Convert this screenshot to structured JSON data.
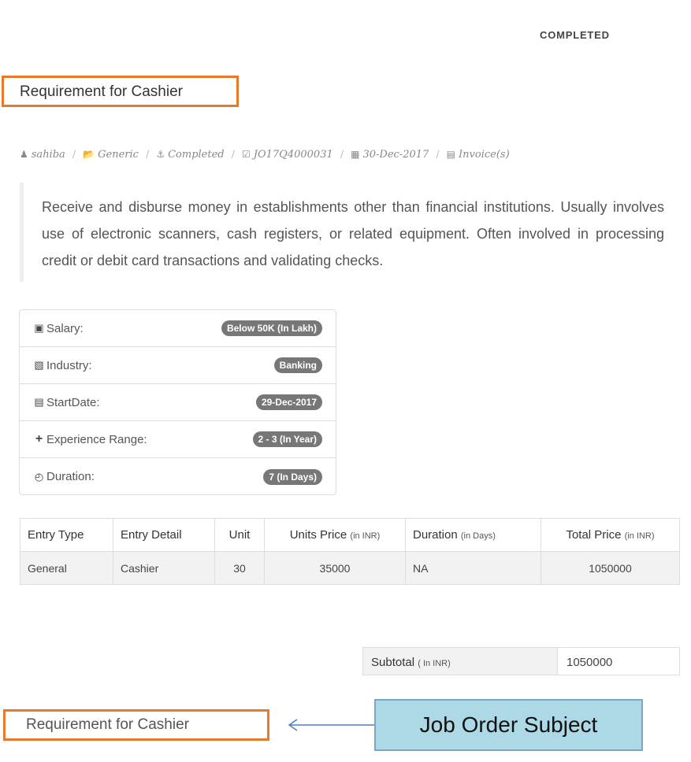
{
  "status": "COMPLETED",
  "title": "Requirement for Cashier",
  "meta": {
    "user": "sahiba",
    "category": "Generic",
    "state": "Completed",
    "job_id": "JO17Q4000031",
    "date": "30-Dec-2017",
    "invoice": "Invoice(s)",
    "separator": "/"
  },
  "description": "Receive and disburse money in establishments other than financial institutions. Usually involves use of electronic scanners, cash registers, or related equipment. Often involved in processing credit or debit card transactions and validating checks.",
  "details": [
    {
      "icon": "money-icon",
      "label": "Salary:",
      "value": "Below 50K  (In Lakh)"
    },
    {
      "icon": "building-icon",
      "label": "Industry:",
      "value": "Banking"
    },
    {
      "icon": "ticket-icon",
      "label": "StartDate:",
      "value": "29-Dec-2017"
    },
    {
      "icon": "plus-icon",
      "label": "Experience Range:",
      "value": "2 - 3   (In Year)"
    },
    {
      "icon": "clock-icon",
      "label": "Duration:",
      "value": "7  (In Days)"
    }
  ],
  "table": {
    "headers": [
      {
        "label": "Entry Type",
        "unit": ""
      },
      {
        "label": "Entry Detail",
        "unit": ""
      },
      {
        "label": "Unit",
        "unit": ""
      },
      {
        "label": "Units Price",
        "unit": "(in INR)"
      },
      {
        "label": "Duration",
        "unit": "(in Days)"
      },
      {
        "label": "Total Price",
        "unit": "(in INR)"
      }
    ],
    "rows": [
      [
        "General",
        "Cashier",
        "30",
        "35000",
        "NA",
        "1050000"
      ]
    ]
  },
  "subtotal": {
    "label": "Subtotal",
    "unit": "( In INR)",
    "value": "1050000"
  },
  "annotation": {
    "title_copy": "Requirement for Cashier",
    "callout": "Job Order Subject"
  },
  "colors": {
    "highlight_border": "#e8792b",
    "callout_bg": "#add8e6",
    "badge_bg": "#777777"
  }
}
